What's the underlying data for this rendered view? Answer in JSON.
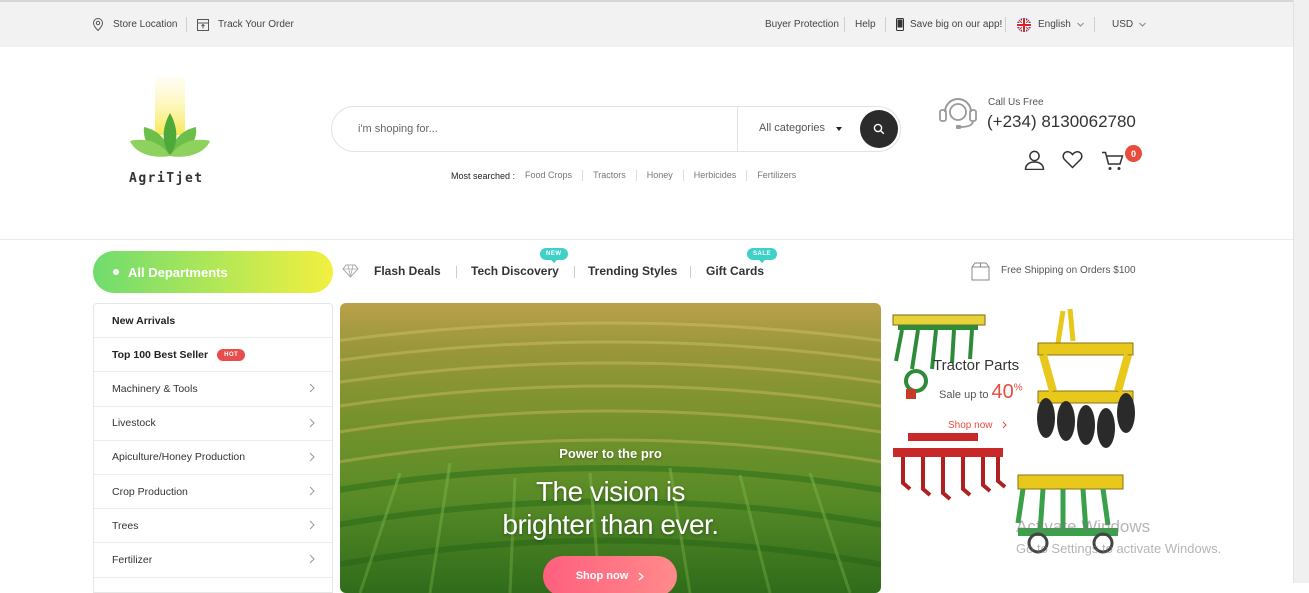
{
  "topbar": {
    "store_location": "Store Location",
    "track_order": "Track Your Order",
    "buyer_protection": "Buyer Protection",
    "help": "Help",
    "app_promo": "Save big on our app!",
    "language": "English",
    "currency": "USD"
  },
  "logo": {
    "text": "AgriTjet"
  },
  "search": {
    "placeholder": "i'm shoping for...",
    "category": "All categories",
    "most_searched_label": "Most searched :",
    "most_searched": [
      "Food Crops",
      "Tractors",
      "Honey",
      "Herbicides",
      "Fertilizers"
    ]
  },
  "contact": {
    "label": "Call Us Free",
    "phone": "(+234) 8130062780"
  },
  "cart": {
    "count": "0"
  },
  "nav": {
    "all_departments": "All Departments",
    "items": [
      {
        "label": "Flash Deals"
      },
      {
        "label": "Tech Discovery",
        "badge": "NEW"
      },
      {
        "label": "Trending Styles"
      },
      {
        "label": "Gift Cards",
        "badge": "SALE"
      }
    ],
    "free_shipping": "Free Shipping on Orders $100"
  },
  "sidebar": {
    "items": [
      {
        "label": "New Arrivals"
      },
      {
        "label": "Top 100 Best Seller",
        "badge": "HOT"
      },
      {
        "label": "Machinery & Tools"
      },
      {
        "label": "Livestock"
      },
      {
        "label": "Apiculture/Honey Production"
      },
      {
        "label": "Crop Production"
      },
      {
        "label": "Trees"
      },
      {
        "label": "Fertilizer"
      }
    ]
  },
  "hero": {
    "subtitle": "Power to the pro",
    "title_line1": "The vision is",
    "title_line2": "brighter than ever.",
    "button": "Shop now"
  },
  "promo": {
    "title": "Tractor Parts",
    "sale_text": "Sale up to",
    "sale_value": "40",
    "sale_unit": "%",
    "shop": "Shop now"
  },
  "watermark": {
    "line1": "Activate Windows",
    "line2": "Go to Settings to activate Windows."
  },
  "colors": {
    "accent_red": "#e84c3d",
    "dept_gradient_start": "#6fdc6f",
    "dept_gradient_end": "#f2f03f",
    "badge_teal": "#3fd0c9"
  }
}
